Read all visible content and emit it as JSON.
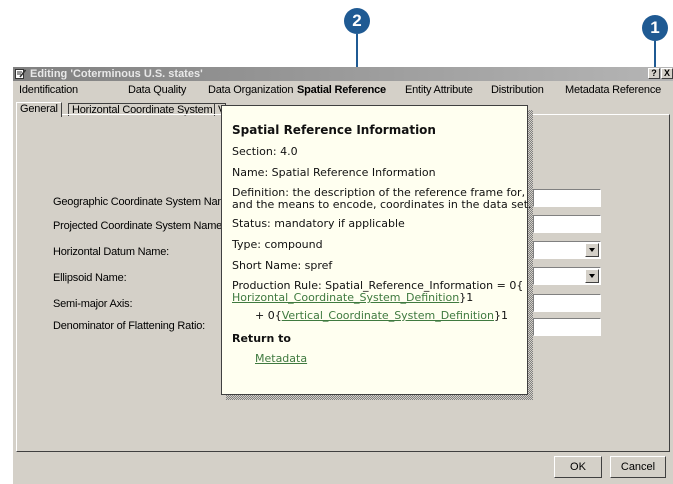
{
  "callouts": {
    "help": "1",
    "menu": "2"
  },
  "window": {
    "title": "Editing 'Coterminous U.S. states'",
    "help_button": "?",
    "close_button": "X"
  },
  "menu": [
    "Identification",
    "Data Quality",
    "Data Organization",
    "Spatial Reference",
    "Entity Attribute",
    "Distribution",
    "Metadata Reference"
  ],
  "active_menu": "Spatial Reference",
  "tabs": [
    "General",
    "Horizontal Coordinate System",
    "V"
  ],
  "fields": [
    {
      "label": "Geographic Coordinate System Name",
      "type": "text",
      "value": ""
    },
    {
      "label": "Projected Coordinate System Name:",
      "type": "text",
      "value": ""
    },
    {
      "label": "Horizontal Datum Name:",
      "type": "combo",
      "value": ""
    },
    {
      "label": "Ellipsoid Name:",
      "type": "combo",
      "value": ""
    },
    {
      "label": "Semi-major Axis:",
      "type": "text",
      "value": ""
    },
    {
      "label": "Denominator of Flattening Ratio:",
      "type": "text",
      "value": ""
    }
  ],
  "buttons": {
    "ok": "OK",
    "cancel": "Cancel"
  },
  "popup": {
    "title": "Spatial Reference Information",
    "section": "Section: 4.0",
    "name": "Name: Spatial Reference Information",
    "definition_1": "Definition: the description of the reference frame for,",
    "definition_2": "and the means to encode, coordinates in the data set.",
    "status": "Status: mandatory if applicable",
    "type": "Type: compound",
    "short_name": "Short Name: spref",
    "rule_1": "Production Rule: Spatial_Reference_Information = 0{",
    "rule_link_1": "Horizontal_Coordinate_System_Definition",
    "rule_suffix_1": "}1",
    "rule_prefix_2": "+ 0{",
    "rule_link_2": "Vertical_Coordinate_System_Definition",
    "rule_suffix_2": "}1",
    "return_to": "Return to",
    "metadata_link": "Metadata"
  }
}
